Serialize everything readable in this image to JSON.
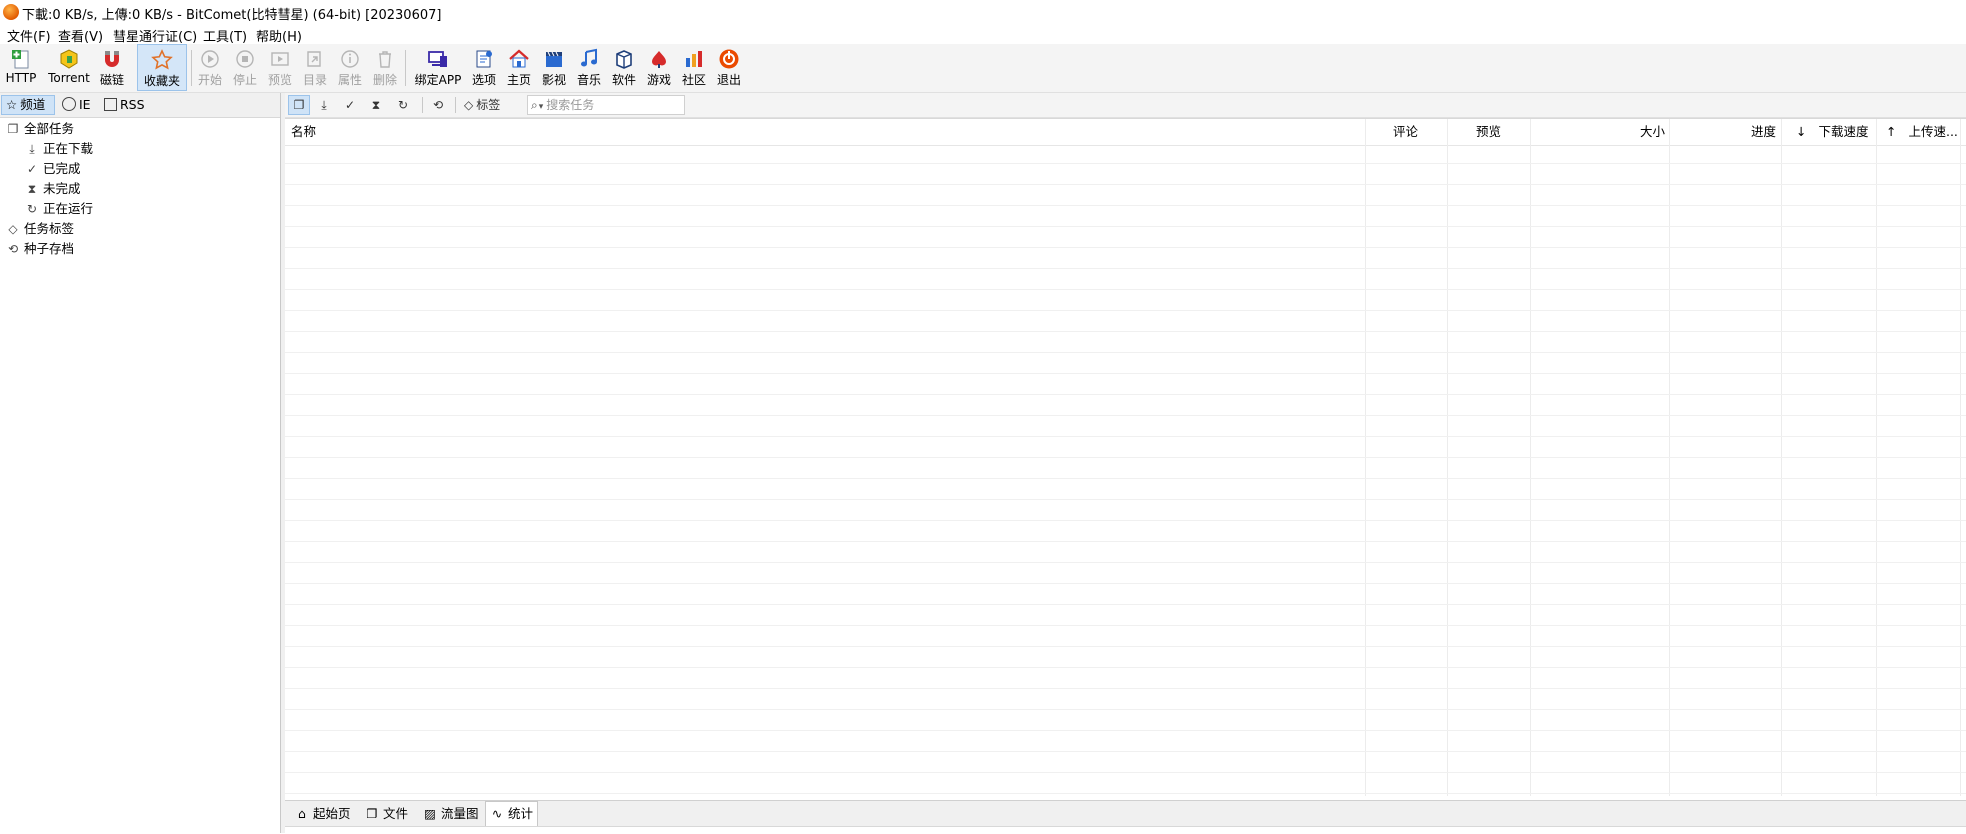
{
  "window": {
    "title": "下載:0 KB/s, 上傳:0 KB/s - BitComet(比特彗星) (64-bit) [20230607]"
  },
  "menu": [
    "文件(F)",
    "查看(V)",
    "彗星通行证(C)",
    "工具(T)",
    "帮助(H)"
  ],
  "toolbar": {
    "http": "HTTP",
    "torrent": "Torrent",
    "magnet": "磁链",
    "favorites": "收藏夹",
    "start": "开始",
    "stop": "停止",
    "preview": "预览",
    "directory": "目录",
    "properties": "属性",
    "delete": "删除",
    "bind_app": "绑定APP",
    "options": "选项",
    "home": "主页",
    "video": "影视",
    "music": "音乐",
    "software": "软件",
    "games": "游戏",
    "community": "社区",
    "exit": "退出"
  },
  "left_tabs": {
    "channels": "频道",
    "ie": "IE",
    "rss": "RSS"
  },
  "tree": {
    "all_tasks": "全部任务",
    "downloading": "正在下载",
    "completed": "已完成",
    "incomplete": "未完成",
    "running": "正在运行",
    "task_tags": "任务标签",
    "torrent_archive": "种子存档"
  },
  "right_toolbar": {
    "tags_label": "标签",
    "search_placeholder": "搜索任务"
  },
  "columns": {
    "name": "名称",
    "comments": "评论",
    "preview": "预览",
    "size": "大小",
    "progress": "进度",
    "download_speed": "下载速度",
    "upload_speed": "上传速..."
  },
  "bottom_tabs": {
    "start_page": "起始页",
    "files": "文件",
    "traffic": "流量图",
    "stats": "统计"
  },
  "icons": {
    "glyph_arrow_down": "⤓",
    "glyph_check": "✓",
    "glyph_hourglass": "⧗",
    "glyph_refresh": "↻",
    "glyph_history": "⟲",
    "glyph_tag": "◇",
    "glyph_star": "☆",
    "glyph_home": "⌂",
    "glyph_search": "⌕",
    "glyph_pages": "❐",
    "glyph_wave": "∿",
    "glyph_up": "↑",
    "glyph_down": "↓"
  },
  "colors": {
    "accent_selected": "#cfe3f7",
    "accent_border": "#9cc3ea"
  }
}
